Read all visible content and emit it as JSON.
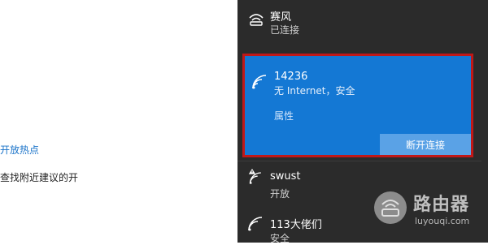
{
  "settings": {
    "hotspot_link": "开放热点",
    "hint_text": "查找附近建议的开"
  },
  "networks": {
    "first": {
      "name": "赛风",
      "status": "已连接",
      "icon": "wifi-icon"
    },
    "selected": {
      "name": "14236",
      "status": "无 Internet，安全",
      "properties_label": "属性",
      "disconnect_label": "断开连接",
      "icon": "wifi-icon"
    },
    "swust": {
      "name": "swust",
      "status": "开放",
      "icon": "wifi-warning-icon"
    },
    "item113": {
      "name": "113大佬们",
      "status": "安全",
      "icon": "wifi-icon"
    }
  },
  "watermark": {
    "name": "路由器",
    "url": "luyouqi.com"
  },
  "colors": {
    "flyout_bg": "#2b2b2b",
    "selected_bg": "#1478d4",
    "highlight_border": "#c01818"
  }
}
